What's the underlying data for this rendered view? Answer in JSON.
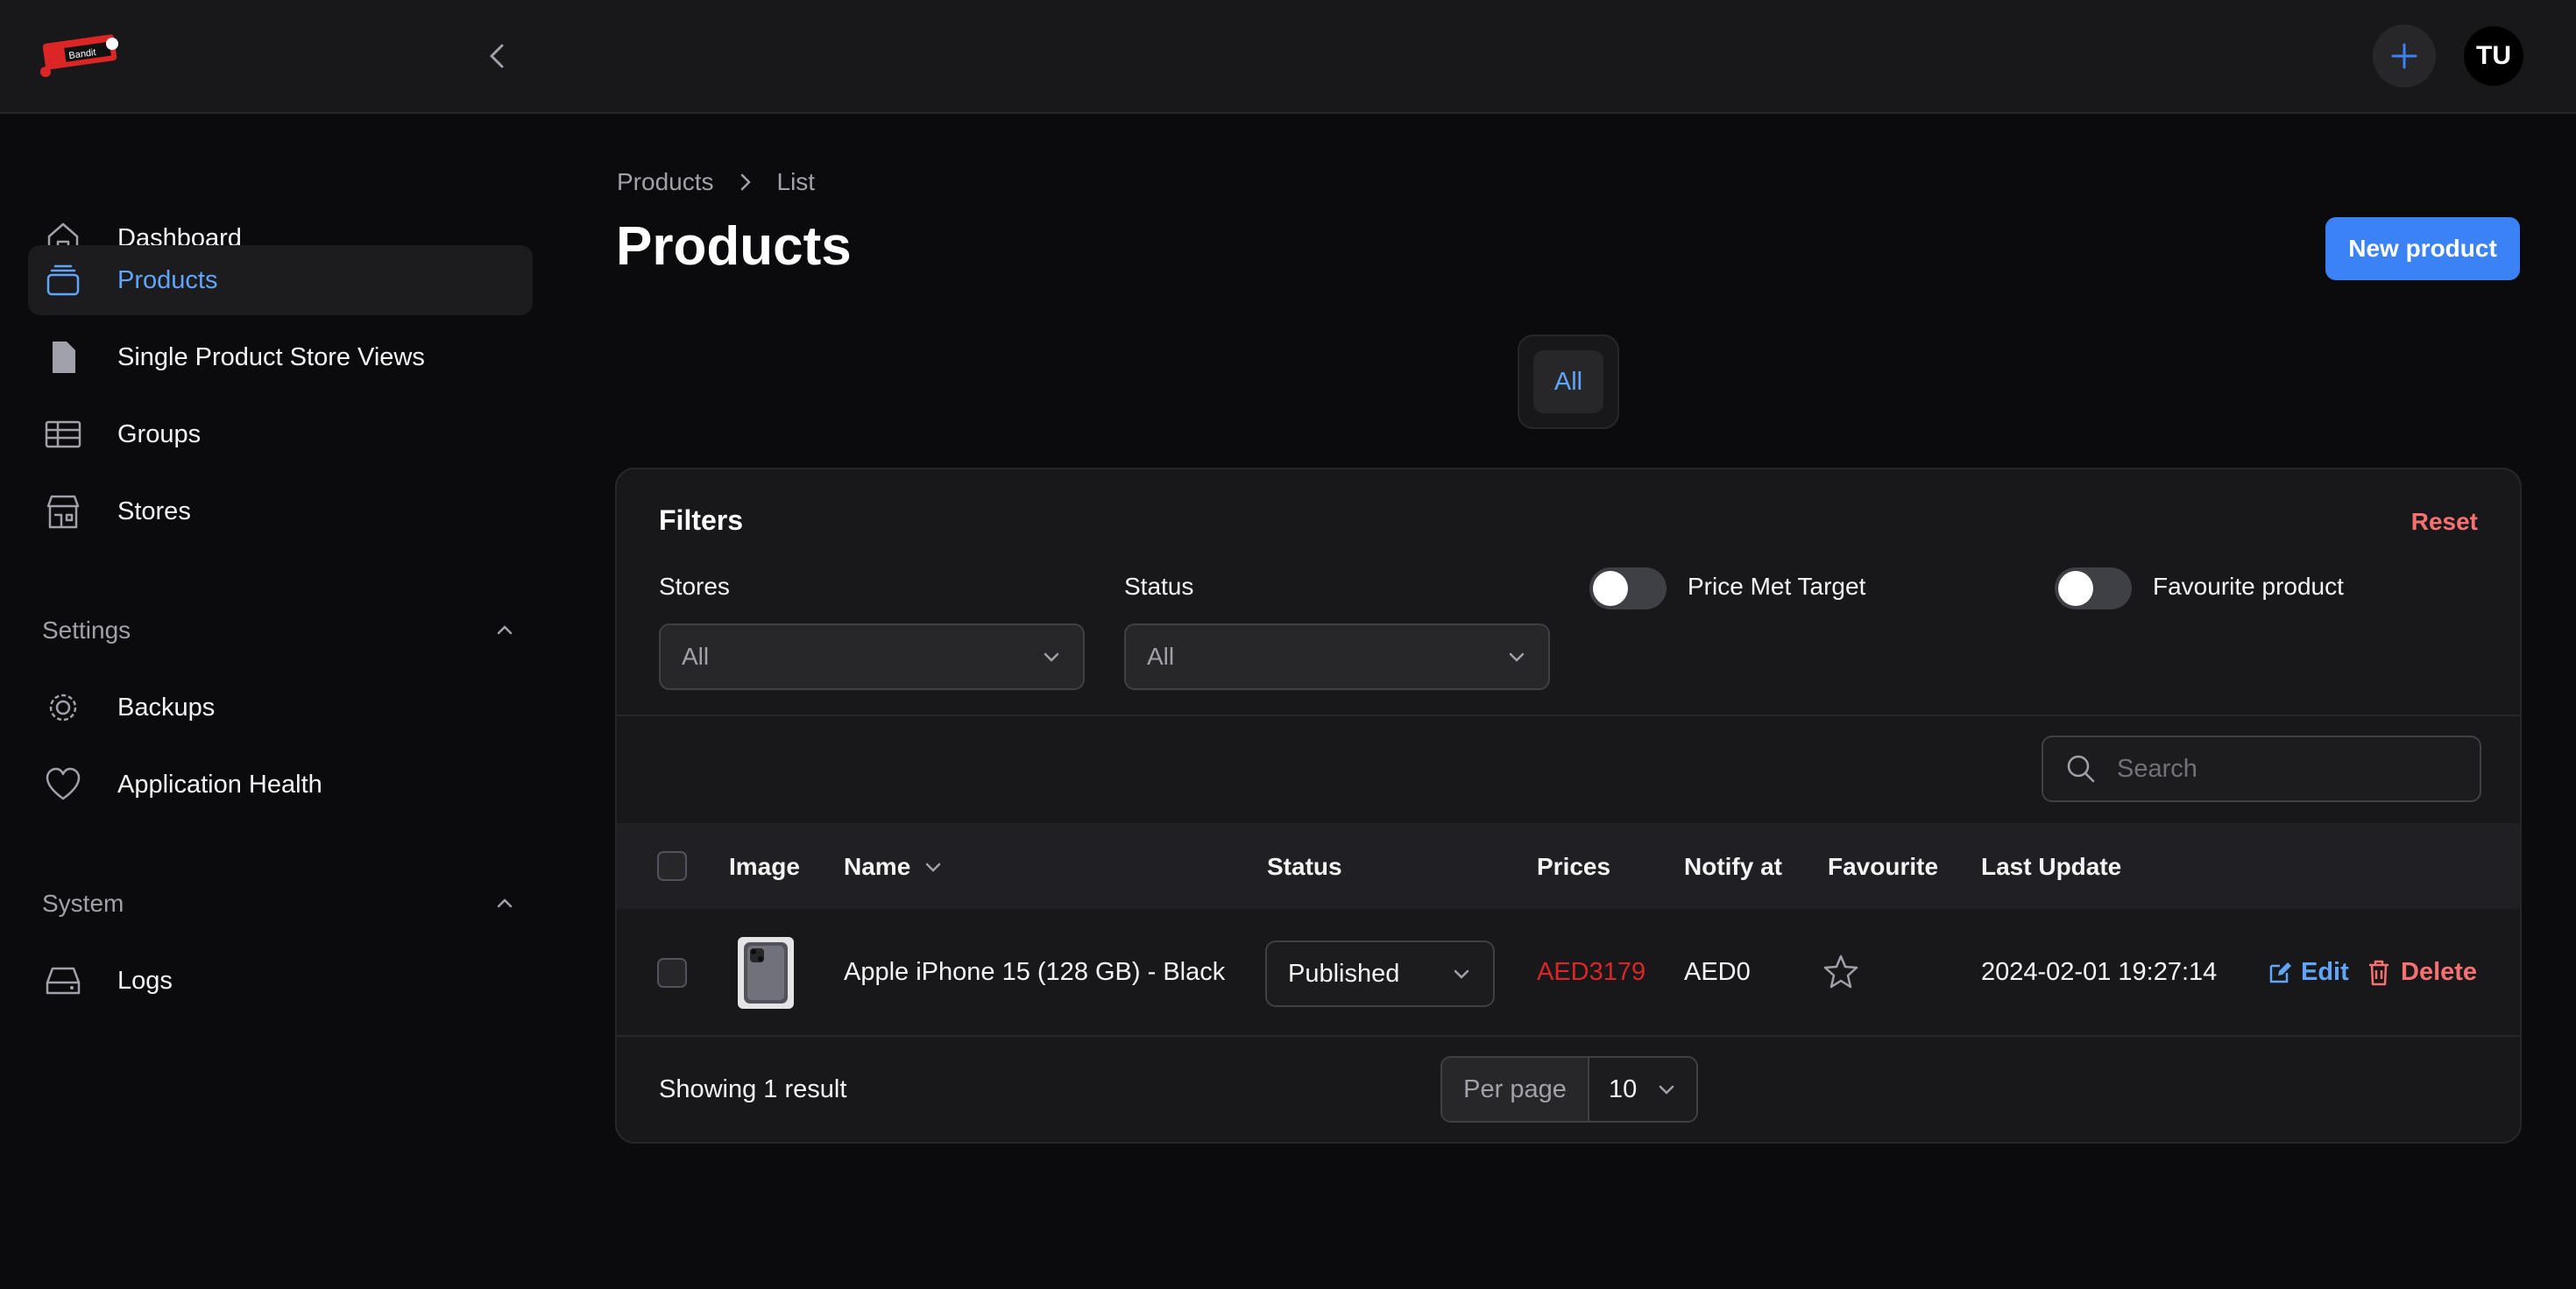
{
  "app": {
    "logo_text": "Bandit",
    "avatar_initials": "TU",
    "accent": "#3b82f6"
  },
  "sidebar": {
    "items": [
      {
        "label": "Dashboard",
        "icon": "home-icon"
      },
      {
        "label": "Products",
        "icon": "stack-icon",
        "active": true
      },
      {
        "label": "Single Product Store Views",
        "icon": "document-icon"
      },
      {
        "label": "Groups",
        "icon": "table-icon"
      },
      {
        "label": "Stores",
        "icon": "store-icon"
      }
    ],
    "settings": {
      "label": "Settings",
      "items": [
        {
          "label": "Backups",
          "icon": "gear-icon"
        },
        {
          "label": "Application Health",
          "icon": "heart-icon"
        }
      ]
    },
    "system": {
      "label": "System",
      "items": [
        {
          "label": "Logs",
          "icon": "drive-icon"
        }
      ]
    }
  },
  "breadcrumb": {
    "root": "Products",
    "current": "List"
  },
  "page": {
    "title": "Products",
    "new_button": "New product"
  },
  "tabs": {
    "all": "All"
  },
  "filters": {
    "title": "Filters",
    "reset": "Reset",
    "stores": {
      "label": "Stores",
      "value": "All"
    },
    "status": {
      "label": "Status",
      "value": "All"
    },
    "price_met_target": {
      "label": "Price Met Target",
      "on": false
    },
    "favourite_product": {
      "label": "Favourite product",
      "on": false
    }
  },
  "search": {
    "placeholder": "Search"
  },
  "table": {
    "headers": {
      "image": "Image",
      "name": "Name",
      "status": "Status",
      "prices": "Prices",
      "notify": "Notify at",
      "favourite": "Favourite",
      "last_update": "Last Update"
    },
    "rows": [
      {
        "name": "Apple iPhone 15 (128 GB) - Black",
        "status": "Published",
        "price": "AED3179",
        "price_color": "#dc2626",
        "notify": "AED0",
        "favourite": false,
        "last_update": "2024-02-01 19:27:14",
        "edit": "Edit",
        "delete": "Delete"
      }
    ]
  },
  "footer": {
    "showing": "Showing 1 result",
    "per_page_label": "Per page",
    "per_page_value": "10"
  }
}
